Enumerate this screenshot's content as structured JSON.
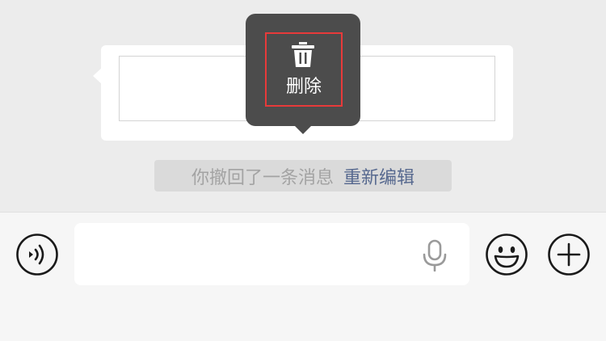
{
  "context_menu": {
    "delete_label": "删除",
    "delete_icon": "trash-icon"
  },
  "recall_notice": {
    "text": "你撤回了一条消息",
    "reedit_label": "重新编辑",
    "link_color": "#57698f"
  },
  "input_bar": {
    "text_value": "",
    "voice_icon": "voice-icon",
    "mic_icon": "microphone-icon",
    "emoji_icon": "emoji-icon",
    "more_icon": "plus-icon"
  },
  "colors": {
    "highlight": "#e83a3a",
    "menu_background": "#4c4c4c"
  }
}
